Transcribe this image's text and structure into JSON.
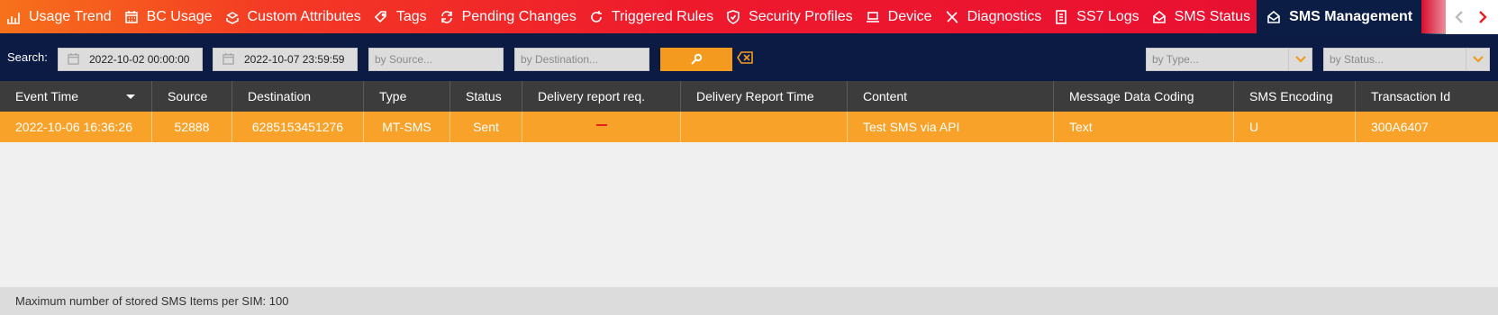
{
  "tabs": [
    {
      "label": "Usage Trend",
      "icon": "bar-chart-icon",
      "active": false
    },
    {
      "label": "BC Usage",
      "icon": "calendar-grid-icon",
      "active": false
    },
    {
      "label": "Custom Attributes",
      "icon": "stack-icon",
      "active": false
    },
    {
      "label": "Tags",
      "icon": "tag-icon",
      "active": false
    },
    {
      "label": "Pending Changes",
      "icon": "sync-icon",
      "active": false
    },
    {
      "label": "Triggered Rules",
      "icon": "refresh-icon",
      "active": false
    },
    {
      "label": "Security Profiles",
      "icon": "shield-icon",
      "active": false
    },
    {
      "label": "Device",
      "icon": "laptop-icon",
      "active": false
    },
    {
      "label": "Diagnostics",
      "icon": "tools-icon",
      "active": false
    },
    {
      "label": "SS7 Logs",
      "icon": "document-icon",
      "active": false
    },
    {
      "label": "SMS Status",
      "icon": "envelope-open-icon",
      "active": false
    },
    {
      "label": "SMS Management",
      "icon": "envelope-open-icon",
      "active": true
    }
  ],
  "filters": {
    "search_label": "Search:",
    "date_from": "2022-10-02 00:00:00",
    "date_to": "2022-10-07 23:59:59",
    "source_placeholder": "by Source...",
    "destination_placeholder": "by Destination...",
    "type_placeholder": "by Type...",
    "status_placeholder": "by Status..."
  },
  "table": {
    "columns": [
      "Event Time",
      "Source",
      "Destination",
      "Type",
      "Status",
      "Delivery report req.",
      "Delivery Report Time",
      "Content",
      "Message Data Coding",
      "SMS Encoding",
      "Transaction Id"
    ],
    "rows": [
      {
        "event_time": "2022-10-06 16:36:26",
        "source": "52888",
        "destination": "6285153451276",
        "type": "MT-SMS",
        "status": "Sent",
        "delivery_report_req": "",
        "delivery_report_time": "",
        "content": "Test SMS via API",
        "message_data_coding": "Text",
        "sms_encoding": "U",
        "transaction_id": "300A6407"
      }
    ]
  },
  "footer": {
    "text": "Maximum number of stored SMS Items per SIM: 100"
  },
  "colors": {
    "accent": "#f39a1f",
    "active_tab": "#0c1d45",
    "header_bg": "#3c3c3c",
    "row_highlight": "#f9a22a"
  }
}
